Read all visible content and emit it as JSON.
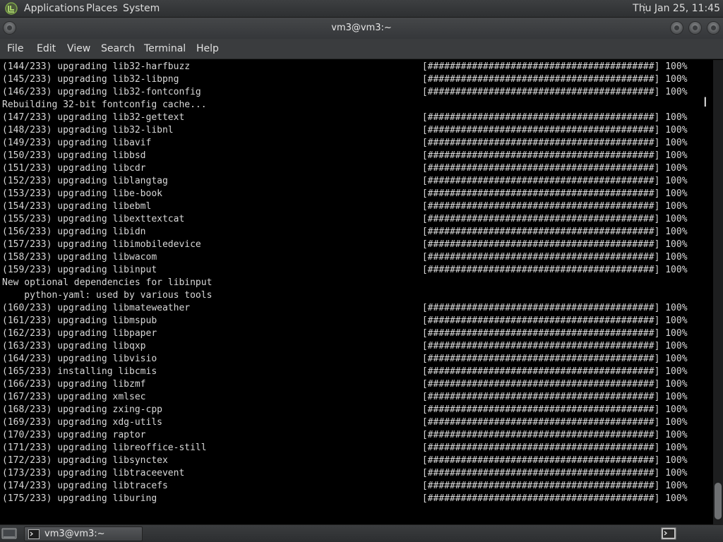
{
  "top_panel": {
    "menus": [
      "Applications",
      "Places",
      "System"
    ],
    "clock": "Thu Jan 25, 11:45"
  },
  "window": {
    "title": "vm3@vm3:~"
  },
  "menubar": {
    "items": [
      "File",
      "Edit",
      "View",
      "Search",
      "Terminal",
      "Help"
    ]
  },
  "terminal": {
    "lines": [
      {
        "text": "(144/233) upgrading lib32-harfbuzz",
        "bar": "[#########################################]",
        "pct": "100%"
      },
      {
        "text": "(145/233) upgrading lib32-libpng",
        "bar": "[#########################################]",
        "pct": "100%"
      },
      {
        "text": "(146/233) upgrading lib32-fontconfig",
        "bar": "[#########################################]",
        "pct": "100%"
      },
      {
        "text": "Rebuilding 32-bit fontconfig cache...",
        "bar": "",
        "pct": ""
      },
      {
        "text": "(147/233) upgrading lib32-gettext",
        "bar": "[#########################################]",
        "pct": "100%"
      },
      {
        "text": "(148/233) upgrading lib32-libnl",
        "bar": "[#########################################]",
        "pct": "100%"
      },
      {
        "text": "(149/233) upgrading libavif",
        "bar": "[#########################################]",
        "pct": "100%"
      },
      {
        "text": "(150/233) upgrading libbsd",
        "bar": "[#########################################]",
        "pct": "100%"
      },
      {
        "text": "(151/233) upgrading libcdr",
        "bar": "[#########################################]",
        "pct": "100%"
      },
      {
        "text": "(152/233) upgrading liblangtag",
        "bar": "[#########################################]",
        "pct": "100%"
      },
      {
        "text": "(153/233) upgrading libe-book",
        "bar": "[#########################################]",
        "pct": "100%"
      },
      {
        "text": "(154/233) upgrading libebml",
        "bar": "[#########################################]",
        "pct": "100%"
      },
      {
        "text": "(155/233) upgrading libexttextcat",
        "bar": "[#########################################]",
        "pct": "100%"
      },
      {
        "text": "(156/233) upgrading libidn",
        "bar": "[#########################################]",
        "pct": "100%"
      },
      {
        "text": "(157/233) upgrading libimobiledevice",
        "bar": "[#########################################]",
        "pct": "100%"
      },
      {
        "text": "(158/233) upgrading libwacom",
        "bar": "[#########################################]",
        "pct": "100%"
      },
      {
        "text": "(159/233) upgrading libinput",
        "bar": "[#########################################]",
        "pct": "100%"
      },
      {
        "text": "New optional dependencies for libinput",
        "bar": "",
        "pct": ""
      },
      {
        "text": "    python-yaml: used by various tools",
        "bar": "",
        "pct": ""
      },
      {
        "text": "(160/233) upgrading libmateweather",
        "bar": "[#########################################]",
        "pct": "100%"
      },
      {
        "text": "(161/233) upgrading libmspub",
        "bar": "[#########################################]",
        "pct": "100%"
      },
      {
        "text": "(162/233) upgrading libpaper",
        "bar": "[#########################################]",
        "pct": "100%"
      },
      {
        "text": "(163/233) upgrading libqxp",
        "bar": "[#########################################]",
        "pct": "100%"
      },
      {
        "text": "(164/233) upgrading libvisio",
        "bar": "[#########################################]",
        "pct": "100%"
      },
      {
        "text": "(165/233) installing libcmis",
        "bar": "[#########################################]",
        "pct": "100%"
      },
      {
        "text": "(166/233) upgrading libzmf",
        "bar": "[#########################################]",
        "pct": "100%"
      },
      {
        "text": "(167/233) upgrading xmlsec",
        "bar": "[#########################################]",
        "pct": "100%"
      },
      {
        "text": "(168/233) upgrading zxing-cpp",
        "bar": "[#########################################]",
        "pct": "100%"
      },
      {
        "text": "(169/233) upgrading xdg-utils",
        "bar": "[#########################################]",
        "pct": "100%"
      },
      {
        "text": "(170/233) upgrading raptor",
        "bar": "[#########################################]",
        "pct": "100%"
      },
      {
        "text": "(171/233) upgrading libreoffice-still",
        "bar": "[#########################################]",
        "pct": "100%"
      },
      {
        "text": "(172/233) upgrading libsynctex",
        "bar": "[#########################################]",
        "pct": "100%"
      },
      {
        "text": "(173/233) upgrading libtraceevent",
        "bar": "[#########################################]",
        "pct": "100%"
      },
      {
        "text": "(174/233) upgrading libtracefs",
        "bar": "[#########################################]",
        "pct": "100%"
      },
      {
        "text": "(175/233) upgrading liburing",
        "bar": "[#########################################]",
        "pct": "100%"
      }
    ],
    "scrollbar": {
      "thumb_start_fraction": 0.91,
      "thumb_size_fraction": 0.08
    }
  },
  "taskbar": {
    "window_button_label": "vm3@vm3:~"
  },
  "icons": {
    "distro_logo": "mint-logo-icon",
    "show_desktop": "show-desktop-icon",
    "terminal": "terminal-icon"
  }
}
